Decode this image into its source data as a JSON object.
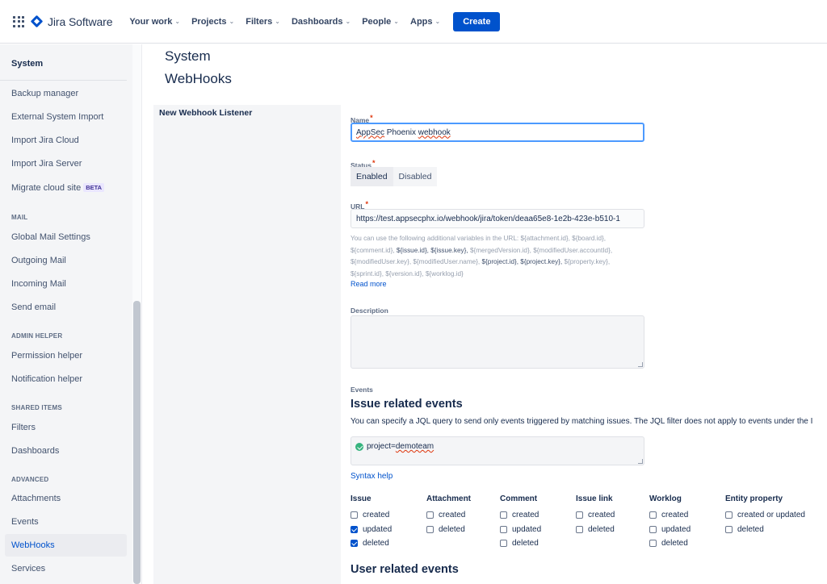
{
  "topnav": {
    "product": "Jira Software",
    "items": [
      "Your work",
      "Projects",
      "Filters",
      "Dashboards",
      "People",
      "Apps"
    ],
    "create_label": "Create"
  },
  "sidebar": {
    "heading": "System",
    "items_top": [
      "Backup manager",
      "External System Import",
      "Import Jira Cloud",
      "Import Jira Server",
      "Migrate cloud site"
    ],
    "beta_badge": "BETA",
    "mail": {
      "title": "MAIL",
      "items": [
        "Global Mail Settings",
        "Outgoing Mail",
        "Incoming Mail",
        "Send email"
      ]
    },
    "admin": {
      "title": "ADMIN HELPER",
      "items": [
        "Permission helper",
        "Notification helper"
      ]
    },
    "shared": {
      "title": "SHARED ITEMS",
      "items": [
        "Filters",
        "Dashboards"
      ]
    },
    "advanced": {
      "title": "ADVANCED",
      "items": [
        "Attachments",
        "Events",
        "WebHooks",
        "Services"
      ]
    }
  },
  "page": {
    "title": "System",
    "subtitle": "WebHooks",
    "panel_title": "New Webhook Listener"
  },
  "form": {
    "name_label": "Name",
    "name_value_a": "AppSec",
    "name_value_b": " Phoenix ",
    "name_value_c": "webhook",
    "status_label": "Status",
    "status_enabled": "Enabled",
    "status_disabled": "Disabled",
    "url_label": "URL",
    "url_value": "https://test.appsecphx.io/webhook/jira/token/deaa65e8-1e2b-423e-b510-1",
    "help_intro": "You can use the following additional variables in the URL: ",
    "help_vars": [
      {
        "text": "${attachment.id}, ",
        "hl": false
      },
      {
        "text": "${board.id}, ",
        "hl": false
      },
      {
        "text": "${comment.id}, ",
        "hl": false
      },
      {
        "text": "${issue.id}, ",
        "hl": true
      },
      {
        "text": "${issue.key}, ",
        "hl": true
      },
      {
        "text": "${mergedVersion.id}, ",
        "hl": false
      },
      {
        "text": "${modifiedUser.accountId}, ",
        "hl": false
      },
      {
        "text": "${modifiedUser.key}, ",
        "hl": false
      },
      {
        "text": "${modifiedUser.name}, ",
        "hl": false
      },
      {
        "text": "${project.id}, ",
        "hl": true
      },
      {
        "text": "${project.key}, ",
        "hl": true
      },
      {
        "text": "${property.key}, ",
        "hl": false
      },
      {
        "text": "${sprint.id}, ",
        "hl": false
      },
      {
        "text": "${version.id}, ",
        "hl": false
      },
      {
        "text": "${worklog.id}",
        "hl": false
      }
    ],
    "read_more": "Read more",
    "description_label": "Description",
    "events_label": "Events",
    "issue_events_heading": "Issue related events",
    "jql_desc": "You can specify a JQL query to send only events triggered by matching issues. The JQL filter does not apply to events under the I",
    "jql_prefix": "project=",
    "jql_value": "demoteam",
    "syntax_help": "Syntax help",
    "user_events_heading": "User related events"
  },
  "events": [
    {
      "title": "Issue",
      "options": [
        {
          "label": "created",
          "checked": false
        },
        {
          "label": "updated",
          "checked": true
        },
        {
          "label": "deleted",
          "checked": true
        }
      ]
    },
    {
      "title": "Attachment",
      "options": [
        {
          "label": "created",
          "checked": false
        },
        {
          "label": "deleted",
          "checked": false
        }
      ]
    },
    {
      "title": "Comment",
      "options": [
        {
          "label": "created",
          "checked": false
        },
        {
          "label": "updated",
          "checked": false
        },
        {
          "label": "deleted",
          "checked": false
        }
      ]
    },
    {
      "title": "Issue link",
      "options": [
        {
          "label": "created",
          "checked": false
        },
        {
          "label": "deleted",
          "checked": false
        }
      ]
    },
    {
      "title": "Worklog",
      "options": [
        {
          "label": "created",
          "checked": false
        },
        {
          "label": "updated",
          "checked": false
        },
        {
          "label": "deleted",
          "checked": false
        }
      ]
    },
    {
      "title": "Entity property",
      "options": [
        {
          "label": "created or updated",
          "checked": false
        },
        {
          "label": "deleted",
          "checked": false
        }
      ]
    }
  ]
}
